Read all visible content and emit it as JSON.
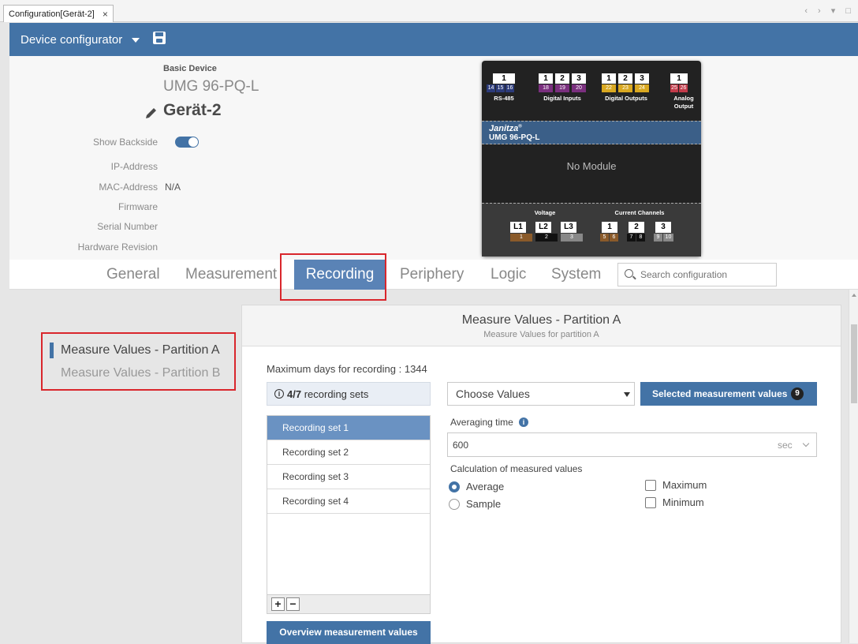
{
  "window": {
    "tab_label": "Configuration[Gerät-2]",
    "tab_close": "×",
    "controls": "‹ › ▾ □"
  },
  "titlebar": {
    "title": "Device configurator"
  },
  "device": {
    "basic_label": "Basic Device",
    "model": "UMG 96-PQ-L",
    "name": "Gerät-2",
    "show_backside_label": "Show Backside",
    "show_backside_on": true,
    "ip_label": "IP-Address",
    "ip_value": "",
    "mac_label": "MAC-Address",
    "mac_value": "N/A",
    "firmware_label": "Firmware",
    "serial_label": "Serial Number",
    "hw_rev_label": "Hardware Revision"
  },
  "graphic": {
    "top_terminals": [
      "1",
      "1",
      "2",
      "3",
      "1",
      "2",
      "3",
      "1"
    ],
    "top_pins": [
      "14",
      "15",
      "16",
      "18",
      "19",
      "20",
      "22",
      "23",
      "24",
      "25",
      "26"
    ],
    "groups": [
      "RS-485",
      "Digital Inputs",
      "Digital Outputs",
      "Analog Output"
    ],
    "brand": "Janitza",
    "brand_mark": "®",
    "brand_model": "UMG 96-PQ-L",
    "no_module": "No Module",
    "voltage_label": "Voltage",
    "current_label": "Current Channels",
    "voltage_terminals": [
      "L1",
      "L2",
      "L3"
    ],
    "voltage_pins": [
      "1",
      "2",
      "3"
    ],
    "current_terminals": [
      "1",
      "2",
      "3"
    ],
    "current_pins": [
      "5",
      "6",
      "7",
      "8",
      "9",
      "10"
    ]
  },
  "nav": {
    "tabs": [
      "General",
      "Measurement",
      "Recording",
      "Periphery",
      "Logic",
      "System"
    ],
    "active": "Recording",
    "search_placeholder": "Search configuration"
  },
  "partitions": {
    "items": [
      "Measure Values - Partition A",
      "Measure Values - Partition B"
    ],
    "selected": "Measure Values - Partition A"
  },
  "panel": {
    "title": "Measure Values - Partition A",
    "subtitle": "Measure Values for partition A",
    "max_days_label": "Maximum days for recording : 1344",
    "sets_count_bold": "4/7",
    "sets_count_text": "recording sets",
    "recording_sets": [
      "Recording set 1",
      "Recording set 2",
      "Recording set 3",
      "Recording set 4"
    ],
    "selected_set": "Recording set 1",
    "add_label": "+",
    "remove_label": "−",
    "overview_button": "Overview measurement values",
    "choose_values": "Choose Values",
    "selected_values_button": "Selected measurement values",
    "selected_values_count": "9",
    "averaging_label": "Averaging time",
    "averaging_value": "600",
    "averaging_unit": "sec",
    "calc_label": "Calculation of measured values",
    "opt_average": "Average",
    "opt_sample": "Sample",
    "opt_maximum": "Maximum",
    "opt_minimum": "Minimum"
  },
  "colors": {
    "brand_blue": "#4373a6",
    "active_tab": "#5a83b6",
    "highlight_red": "#d9262c"
  }
}
